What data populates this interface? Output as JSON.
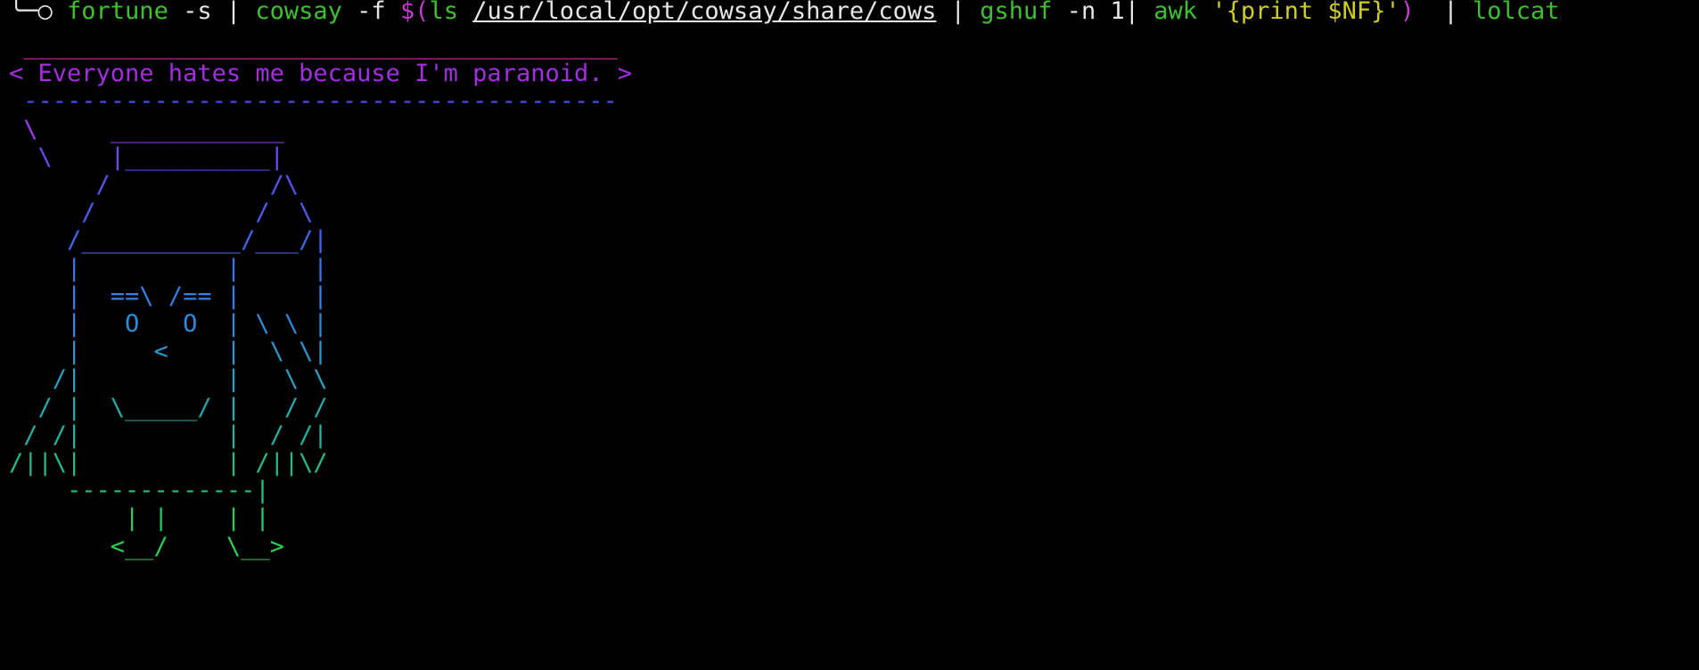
{
  "terminal": {
    "command": {
      "prompt_glyph": "╰─○",
      "tokens": [
        {
          "text": "fortune",
          "color": "#3ec12f"
        },
        {
          "text": " -s | ",
          "color": "#e6e6e6"
        },
        {
          "text": "cowsay",
          "color": "#3ec12f"
        },
        {
          "text": " -f ",
          "color": "#e6e6e6"
        },
        {
          "text": "$(",
          "color": "#c739d3"
        },
        {
          "text": "ls ",
          "color": "#3ec12f"
        },
        {
          "text": "/usr/local/opt/cowsay/share/cows",
          "color": "#e6e6e6",
          "underline": true
        },
        {
          "text": " | ",
          "color": "#e6e6e6"
        },
        {
          "text": "gshuf",
          "color": "#3ec12f"
        },
        {
          "text": " -n 1| ",
          "color": "#e6e6e6"
        },
        {
          "text": "awk",
          "color": "#3ec12f"
        },
        {
          "text": " ",
          "color": "#e6e6e6"
        },
        {
          "text": "'{print $NF}'",
          "color": "#cdcd26"
        },
        {
          "text": ")",
          "color": "#c739d3"
        },
        {
          "text": "  | ",
          "color": "#e6e6e6"
        },
        {
          "text": "lolcat",
          "color": "#3ec12f"
        }
      ]
    },
    "output_lines": [
      {
        "text": " _________________________________________",
        "color": "#d93bb5"
      },
      {
        "text": "< Everyone hates me because I'm paranoid. >",
        "color": "#a12ee0"
      },
      {
        "text": " -----------------------------------------",
        "color": "#4a4ff0"
      },
      {
        "text": " \\     ____________",
        "color": "#9a3df0"
      },
      {
        "text": "  \\    |__________|",
        "color": "#6b48f2"
      },
      {
        "text": "      /           /\\",
        "color": "#5a52f2"
      },
      {
        "text": "     /           /  \\",
        "color": "#4d5cf0"
      },
      {
        "text": "    /___________/___/|",
        "color": "#3f67ee"
      },
      {
        "text": "    |          |     |",
        "color": "#3a72ea"
      },
      {
        "text": "    |  ==\\ /== |     |",
        "color": "#357ee3"
      },
      {
        "text": "    |   O   O  | \\ \\ |",
        "color": "#308ad8"
      },
      {
        "text": "    |     <    |  \\ \\|",
        "color": "#2c95cb"
      },
      {
        "text": "   /|          |   \\ \\",
        "color": "#28a0bd"
      },
      {
        "text": "  / |  \\_____/ |   / /",
        "color": "#25aaad"
      },
      {
        "text": " / /|          |  / /|",
        "color": "#22b39c"
      },
      {
        "text": "/||\\|          | /||\\/",
        "color": "#22bc8a"
      },
      {
        "text": "    -------------|",
        "color": "#22c378"
      },
      {
        "text": "        | |    | |",
        "color": "#25ca65"
      },
      {
        "text": "       <__/    \\__>",
        "color": "#2ad052"
      }
    ]
  }
}
